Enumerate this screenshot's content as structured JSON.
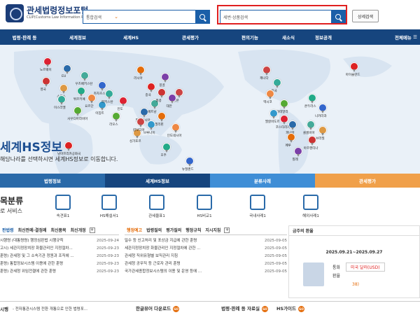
{
  "header": {
    "logo_title": "관세법령정보포털",
    "logo_sub": "CLIP(Customs Law Information Portal)",
    "search1": {
      "select": "통합검색",
      "placeholder": ""
    },
    "search2": {
      "select": "세번·상품검색",
      "placeholder": ""
    },
    "detail_search": "상세검색"
  },
  "nav": {
    "items": [
      "법령·판례 등",
      "세계정보",
      "세계HS",
      "관세평가",
      "편의기능",
      "새소식",
      "정보공개",
      "전체메뉴"
    ],
    "active": 2
  },
  "map": {
    "title": "세계HS정보",
    "subtitle": "해당나라를 선택하시면 세계HS정보로 이동합니다.",
    "labels": [
      "노르웨이",
      "EU",
      "우즈베키스탄",
      "러시아",
      "몽골",
      "영국",
      "스위스",
      "튀르키예",
      "카자흐스탄",
      "중국",
      "일본",
      "이스라엘",
      "요르단",
      "사우디아라비아",
      "이집트",
      "인도",
      "말레이시아",
      "베트남",
      "필리핀",
      "대만",
      "홍콩",
      "싱가포르",
      "호주",
      "뉴질랜드",
      "남아프리카공화국",
      "캐나다",
      "미국",
      "멕시코",
      "과테말라",
      "엘살바도르",
      "코스타리카",
      "파나마",
      "콜롬비아",
      "페루",
      "칠레",
      "아르헨티나",
      "브라질",
      "온두라스",
      "니카라과",
      "아이슬란드",
      "캄보디아",
      "파키스탄",
      "인도네시아",
      "라오스",
      "브루나이"
    ]
  },
  "tabs": {
    "items": [
      "법령정보",
      "세계HS정보",
      "분류사례",
      "관세평가"
    ],
    "colors": [
      "#2a6aa9",
      "#16457e",
      "#3f8ed6",
      "#f0a04a"
    ]
  },
  "services": {
    "title": "목분류",
    "subtitle": "로 서비스",
    "items": [
      "속견표1",
      "HS해설서1",
      "관세율표1",
      "HS비교1",
      "국내사례1",
      "해외사례1"
    ]
  },
  "panel_left": {
    "tabs": [
      "판법령",
      "최신판례·결정례",
      "최신품목",
      "최신개정"
    ],
    "rows": [
      {
        "t": "시행령 (대통령령) 행정심판법 시행규칙",
        "d": "2025-09-24"
      },
      {
        "t": "고시) 세관지정장치장 화물관리인 지정절차...",
        "d": "2025-09-23"
      },
      {
        "t": "훈령) 관세청 및 그 소속기관 정원과 조직에 ...",
        "d": "2025-09-23"
      },
      {
        "t": "훈령) 통합정보시스템 이용에 관한 훈령",
        "d": "2025-09-23"
      },
      {
        "t": "훈령) 관세청 위임전결에 관한 훈령",
        "d": "2025-09-23"
      }
    ]
  },
  "panel_mid": {
    "tabs": [
      "행정예고",
      "법령질의",
      "평가질의",
      "행정규칙",
      "지시지침"
    ],
    "rows": [
      {
        "t": "밀수 등 신고처리 및 포상금 지급에 관한 훈령",
        "d": "2025-09-05"
      },
      {
        "t": "세관지정장치장 화물관리인 지정절차에 관한 ...",
        "d": "2025-09-05"
      },
      {
        "t": "관세청 직위유형별 보직관리 지침",
        "d": "2025-09-05"
      },
      {
        "t": "관세청 공무직 등 근로자 관리 훈령",
        "d": "2025-09-05"
      },
      {
        "t": "국가관세종합정보시스템의 이용 및 운영 등에 ...",
        "d": "2025-09-05"
      }
    ]
  },
  "panel_right": {
    "title": "금주의 환율",
    "period": "2025.09.21~2025.09.27",
    "currency_label": "통화",
    "currency_value": "미국 달러(USD)",
    "rate_label": "환율",
    "rate_value": "",
    "change_value": "38)"
  },
  "bottom": {
    "items": [
      "시행",
      "- 전자통관시스템 전환 개통으로 인한 법령포...",
      "한글뷰어 다운로드",
      "법령·판례 등 자료실",
      "HS가이드"
    ],
    "go": "GO"
  }
}
